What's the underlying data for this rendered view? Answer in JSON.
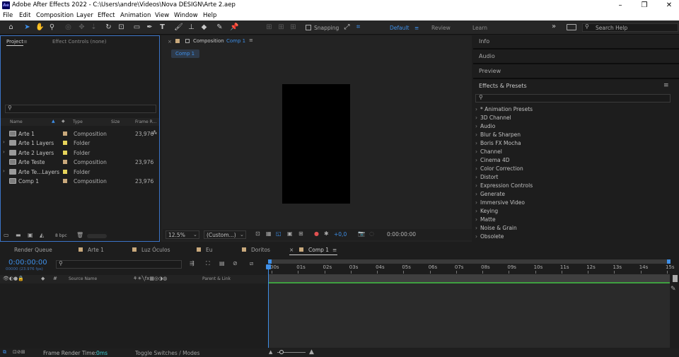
{
  "app": {
    "title": "Adobe After Effects 2022 - C:\\Users\\andre\\Videos\\Nova DESIGN\\Arte 2.aep",
    "logo": "Ae"
  },
  "menu": [
    "File",
    "Edit",
    "Composition",
    "Layer",
    "Effect",
    "Animation",
    "View",
    "Window",
    "Help"
  ],
  "toolbar": {
    "snapping": "Snapping",
    "workspaces": {
      "default": "Default",
      "review": "Review",
      "learn": "Learn"
    },
    "search_help": "Search Help"
  },
  "project": {
    "tab_project": "Project",
    "tab_effect_controls": "Effect Controls (none)",
    "columns": {
      "name": "Name",
      "type": "Type",
      "size": "Size",
      "frame_rate": "Frame R..."
    },
    "items": [
      {
        "name": "Arte 1",
        "type": "Composition",
        "frame_rate": "23,976",
        "color": "#c9a97c",
        "kind": "comp"
      },
      {
        "name": "Arte 1 Layers",
        "type": "Folder",
        "frame_rate": "",
        "color": "#e6d35a",
        "kind": "folder"
      },
      {
        "name": "Arte 2 Layers",
        "type": "Folder",
        "frame_rate": "",
        "color": "#e6d35a",
        "kind": "folder"
      },
      {
        "name": "Arte Teste",
        "type": "Composition",
        "frame_rate": "23,976",
        "color": "#c9a97c",
        "kind": "comp"
      },
      {
        "name": "Arte Te...Layers",
        "type": "Folder",
        "frame_rate": "",
        "color": "#e6d35a",
        "kind": "folder"
      },
      {
        "name": "Comp 1",
        "type": "Composition",
        "frame_rate": "23,976",
        "color": "#c9a97c",
        "kind": "comp"
      }
    ],
    "bpc": "8 bpc"
  },
  "composition": {
    "tab_label": "Composition",
    "tab_comp": "Comp 1",
    "sub_tab": "Comp 1",
    "zoom": "12.5%",
    "resolution": "(Custom...)",
    "exposure": "+0,0",
    "timecode": "0:00:00:00"
  },
  "right": {
    "info": "Info",
    "audio": "Audio",
    "preview": "Preview",
    "effects_presets": "Effects & Presets",
    "effects": [
      "* Animation Presets",
      "3D Channel",
      "Audio",
      "Blur & Sharpen",
      "Boris FX Mocha",
      "Channel",
      "Cinema 4D",
      "Color Correction",
      "Distort",
      "Expression Controls",
      "Generate",
      "Immersive Video",
      "Keying",
      "Matte",
      "Noise & Grain",
      "Obsolete"
    ]
  },
  "timeline": {
    "tabs": [
      {
        "label": "Render Queue",
        "color": ""
      },
      {
        "label": "Arte 1",
        "color": "#c9a97c"
      },
      {
        "label": "Luz Óculos",
        "color": "#c9a97c"
      },
      {
        "label": "Eu",
        "color": "#c9a97c"
      },
      {
        "label": "Doritos",
        "color": "#c9a97c"
      },
      {
        "label": "Comp 1",
        "color": "#c9a97c"
      }
    ],
    "current_time": "0:00:00:00",
    "fps": "00000 (23.976 fps)",
    "source_name": "Source Name",
    "parent_link": "Parent & Link",
    "ruler": [
      "00s",
      "01s",
      "02s",
      "03s",
      "04s",
      "05s",
      "06s",
      "07s",
      "08s",
      "09s",
      "10s",
      "11s",
      "12s",
      "13s",
      "14s",
      "15s"
    ],
    "frame_render_label": "Frame Render Time:",
    "frame_render_value": "0ms",
    "toggle": "Toggle Switches / Modes"
  }
}
